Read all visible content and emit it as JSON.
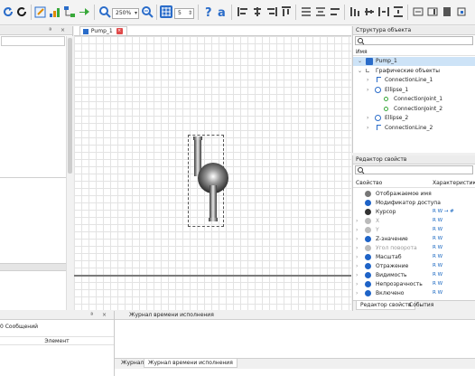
{
  "toolbar": {
    "zoom_value": "250%",
    "grid_value": "5",
    "icons": [
      "refresh-icon",
      "save-icon",
      "edit-icon",
      "chart-icon",
      "network-icon",
      "run-icon",
      "zoom-in-icon",
      "zoom-out-icon",
      "grid-icon",
      "help-icon",
      "text-icon",
      "align-icon"
    ]
  },
  "left_panel": {},
  "canvas": {
    "tab_label": "Pump_1"
  },
  "structure": {
    "title": "Структура объекта",
    "column_name": "Имя",
    "items": [
      {
        "label": "Pump_1",
        "level": 0
      },
      {
        "label": "Графические объекты",
        "level": 1
      },
      {
        "label": "ConnectionLine_1",
        "level": 2
      },
      {
        "label": "Ellipse_1",
        "level": 2
      },
      {
        "label": "ConnectionJoint_1",
        "level": 3
      },
      {
        "label": "ConnectionJoint_2",
        "level": 3
      },
      {
        "label": "Ellipse_2",
        "level": 2
      },
      {
        "label": "ConnectionLine_2",
        "level": 2
      }
    ]
  },
  "props": {
    "title": "Редактор свойств",
    "col_property": "Свойство",
    "col_characteristics": "Характеристики",
    "rows": [
      {
        "name": "Отображаемое имя",
        "ch": "",
        "color": "#777"
      },
      {
        "name": "Модификатор доступа",
        "ch": "",
        "color": "#1e63c7"
      },
      {
        "name": "Курсор",
        "ch": "R W → #",
        "color": "#333"
      },
      {
        "name": "X",
        "ch": "R W",
        "color": "#bbb"
      },
      {
        "name": "Y",
        "ch": "R W",
        "color": "#bbb"
      },
      {
        "name": "Z-значение",
        "ch": "R W",
        "color": "#1e63c7"
      },
      {
        "name": "Угол поворота",
        "ch": "R W",
        "color": "#bbb"
      },
      {
        "name": "Масштаб",
        "ch": "R W",
        "color": "#1e63c7"
      },
      {
        "name": "Отражение",
        "ch": "R W",
        "color": "#1e63c7"
      },
      {
        "name": "Видимость",
        "ch": "R W",
        "color": "#1e63c7"
      },
      {
        "name": "Непрозрачность",
        "ch": "R W",
        "color": "#1e63c7"
      },
      {
        "name": "Включено",
        "ch": "R W",
        "color": "#1e63c7"
      }
    ],
    "tab_props": "Редактор свойств",
    "tab_events": "События"
  },
  "messages": {
    "count_label": "0 Сообщений",
    "column_element": "Элемент"
  },
  "runtime_log": {
    "title": "Журнал времени исполнения",
    "tab_log": "Журнал",
    "tab_runtime": "Журнал времени исполнения"
  },
  "colors": {
    "accent": "#1e63c7",
    "selection": "#cde3f7"
  }
}
